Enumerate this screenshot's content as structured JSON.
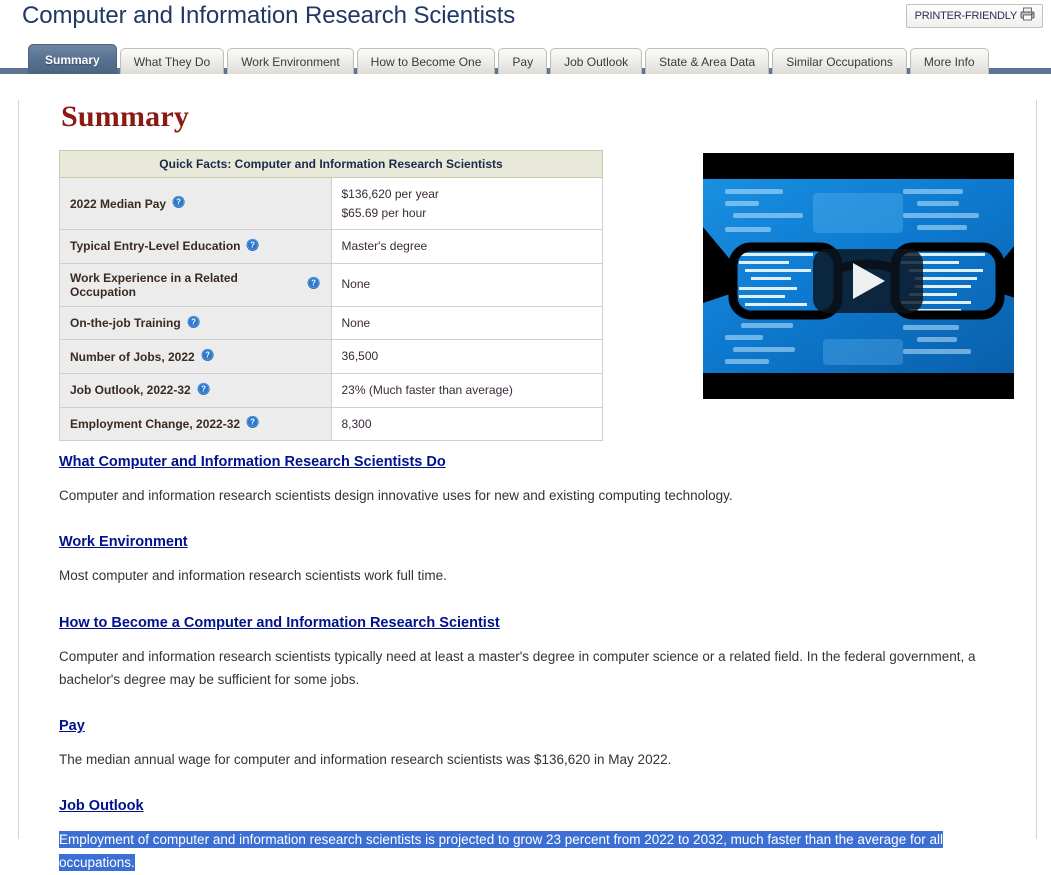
{
  "header": {
    "title": "Computer and Information Research Scientists",
    "printer_button_label": "PRINTER-FRIENDLY",
    "printer_icon": "printer-icon"
  },
  "tabs": [
    {
      "label": "Summary",
      "active": true
    },
    {
      "label": "What They Do",
      "active": false
    },
    {
      "label": "Work Environment",
      "active": false
    },
    {
      "label": "How to Become One",
      "active": false
    },
    {
      "label": "Pay",
      "active": false
    },
    {
      "label": "Job Outlook",
      "active": false
    },
    {
      "label": "State & Area Data",
      "active": false
    },
    {
      "label": "Similar Occupations",
      "active": false
    },
    {
      "label": "More Info",
      "active": false
    }
  ],
  "main": {
    "section_title": "Summary",
    "quick_facts": {
      "caption": "Quick Facts: Computer and Information Research Scientists",
      "help_icon": "help-question-icon",
      "rows": [
        {
          "label": "2022 Median Pay",
          "value": "$136,620 per year\n$65.69 per hour"
        },
        {
          "label": "Typical Entry-Level Education",
          "value": "Master's degree"
        },
        {
          "label": "Work Experience in a Related Occupation",
          "value": "None"
        },
        {
          "label": "On-the-job Training",
          "value": "None"
        },
        {
          "label": "Number of Jobs, 2022",
          "value": "36,500"
        },
        {
          "label": "Job Outlook, 2022-32",
          "value": "23% (Much faster than average)"
        },
        {
          "label": "Employment Change, 2022-32",
          "value": "8,300"
        }
      ]
    },
    "video": {
      "name": "occupation-video-thumbnail",
      "play_icon": "play-button-icon",
      "description": "Eyeglasses bringing blue screen of program code into focus"
    },
    "sections": [
      {
        "link": "What Computer and Information Research Scientists Do",
        "paragraph": "Computer and information research scientists design innovative uses for new and existing computing technology.",
        "selected": false
      },
      {
        "link": "Work Environment",
        "paragraph": "Most computer and information research scientists work full time.",
        "selected": false
      },
      {
        "link": "How to Become a Computer and Information Research Scientist",
        "paragraph": "Computer and information research scientists typically need at least a master's degree in computer science or a related field. In the federal government, a bachelor's degree may be sufficient for some jobs.",
        "selected": false
      },
      {
        "link": "Pay",
        "paragraph": "The median annual wage for computer and information research scientists was $136,620 in May 2022.",
        "selected": false
      },
      {
        "link": "Job Outlook",
        "paragraph": "Employment of computer and information research scientists is projected to grow 23 percent from 2022 to 2032, much faster than the average for all occupations.",
        "selected": true
      }
    ]
  },
  "colors": {
    "title": "#1f3864",
    "section_title": "#8b1a11",
    "active_tab": "#5a7391",
    "tabbar_strip": "#5b7491",
    "link": "#00128c",
    "selection": "#3b6fd4",
    "table_caption_bg": "#e9e9d9",
    "table_label_bg": "#ececec"
  }
}
